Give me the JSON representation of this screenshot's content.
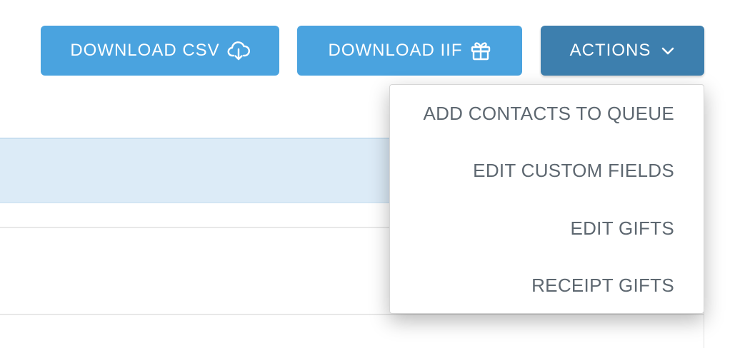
{
  "toolbar": {
    "download_csv_label": "DOWNLOAD CSV",
    "download_iif_label": "DOWNLOAD IIF",
    "actions_label": "ACTIONS"
  },
  "actions_menu": {
    "items": [
      {
        "label": "ADD CONTACTS TO QUEUE"
      },
      {
        "label": "EDIT CUSTOM FIELDS"
      },
      {
        "label": "EDIT GIFTS"
      },
      {
        "label": "RECEIPT GIFTS"
      }
    ]
  },
  "icons": {
    "csv": "cloud-download-icon",
    "iif": "gift-icon",
    "actions": "chevron-down-icon"
  },
  "colors": {
    "primary_button": "#4aa3df",
    "actions_button": "#3d7fae",
    "table_header": "#dcebf7",
    "menu_text": "#5d6770"
  }
}
